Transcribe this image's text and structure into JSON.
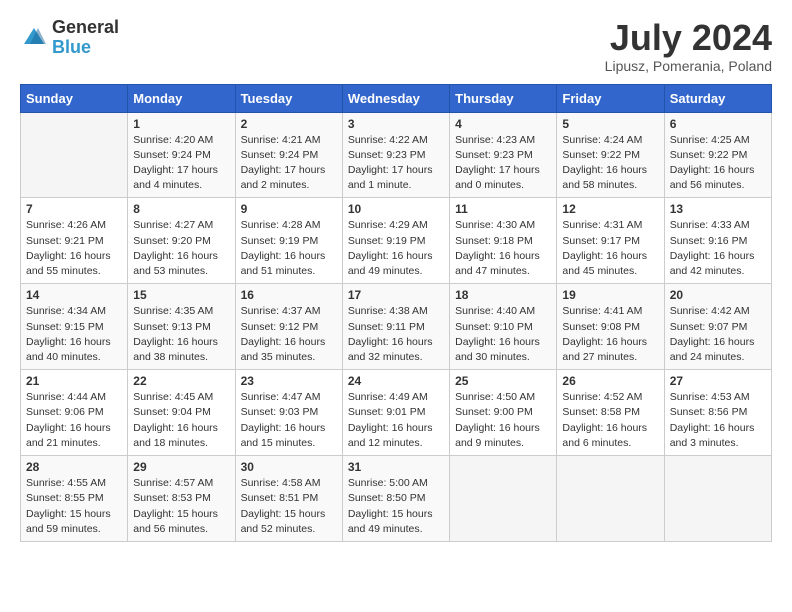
{
  "header": {
    "logo_general": "General",
    "logo_blue": "Blue",
    "title": "July 2024",
    "subtitle": "Lipusz, Pomerania, Poland"
  },
  "days_of_week": [
    "Sunday",
    "Monday",
    "Tuesday",
    "Wednesday",
    "Thursday",
    "Friday",
    "Saturday"
  ],
  "weeks": [
    [
      {
        "day": "",
        "info": ""
      },
      {
        "day": "1",
        "info": "Sunrise: 4:20 AM\nSunset: 9:24 PM\nDaylight: 17 hours\nand 4 minutes."
      },
      {
        "day": "2",
        "info": "Sunrise: 4:21 AM\nSunset: 9:24 PM\nDaylight: 17 hours\nand 2 minutes."
      },
      {
        "day": "3",
        "info": "Sunrise: 4:22 AM\nSunset: 9:23 PM\nDaylight: 17 hours\nand 1 minute."
      },
      {
        "day": "4",
        "info": "Sunrise: 4:23 AM\nSunset: 9:23 PM\nDaylight: 17 hours\nand 0 minutes."
      },
      {
        "day": "5",
        "info": "Sunrise: 4:24 AM\nSunset: 9:22 PM\nDaylight: 16 hours\nand 58 minutes."
      },
      {
        "day": "6",
        "info": "Sunrise: 4:25 AM\nSunset: 9:22 PM\nDaylight: 16 hours\nand 56 minutes."
      }
    ],
    [
      {
        "day": "7",
        "info": "Sunrise: 4:26 AM\nSunset: 9:21 PM\nDaylight: 16 hours\nand 55 minutes."
      },
      {
        "day": "8",
        "info": "Sunrise: 4:27 AM\nSunset: 9:20 PM\nDaylight: 16 hours\nand 53 minutes."
      },
      {
        "day": "9",
        "info": "Sunrise: 4:28 AM\nSunset: 9:19 PM\nDaylight: 16 hours\nand 51 minutes."
      },
      {
        "day": "10",
        "info": "Sunrise: 4:29 AM\nSunset: 9:19 PM\nDaylight: 16 hours\nand 49 minutes."
      },
      {
        "day": "11",
        "info": "Sunrise: 4:30 AM\nSunset: 9:18 PM\nDaylight: 16 hours\nand 47 minutes."
      },
      {
        "day": "12",
        "info": "Sunrise: 4:31 AM\nSunset: 9:17 PM\nDaylight: 16 hours\nand 45 minutes."
      },
      {
        "day": "13",
        "info": "Sunrise: 4:33 AM\nSunset: 9:16 PM\nDaylight: 16 hours\nand 42 minutes."
      }
    ],
    [
      {
        "day": "14",
        "info": "Sunrise: 4:34 AM\nSunset: 9:15 PM\nDaylight: 16 hours\nand 40 minutes."
      },
      {
        "day": "15",
        "info": "Sunrise: 4:35 AM\nSunset: 9:13 PM\nDaylight: 16 hours\nand 38 minutes."
      },
      {
        "day": "16",
        "info": "Sunrise: 4:37 AM\nSunset: 9:12 PM\nDaylight: 16 hours\nand 35 minutes."
      },
      {
        "day": "17",
        "info": "Sunrise: 4:38 AM\nSunset: 9:11 PM\nDaylight: 16 hours\nand 32 minutes."
      },
      {
        "day": "18",
        "info": "Sunrise: 4:40 AM\nSunset: 9:10 PM\nDaylight: 16 hours\nand 30 minutes."
      },
      {
        "day": "19",
        "info": "Sunrise: 4:41 AM\nSunset: 9:08 PM\nDaylight: 16 hours\nand 27 minutes."
      },
      {
        "day": "20",
        "info": "Sunrise: 4:42 AM\nSunset: 9:07 PM\nDaylight: 16 hours\nand 24 minutes."
      }
    ],
    [
      {
        "day": "21",
        "info": "Sunrise: 4:44 AM\nSunset: 9:06 PM\nDaylight: 16 hours\nand 21 minutes."
      },
      {
        "day": "22",
        "info": "Sunrise: 4:45 AM\nSunset: 9:04 PM\nDaylight: 16 hours\nand 18 minutes."
      },
      {
        "day": "23",
        "info": "Sunrise: 4:47 AM\nSunset: 9:03 PM\nDaylight: 16 hours\nand 15 minutes."
      },
      {
        "day": "24",
        "info": "Sunrise: 4:49 AM\nSunset: 9:01 PM\nDaylight: 16 hours\nand 12 minutes."
      },
      {
        "day": "25",
        "info": "Sunrise: 4:50 AM\nSunset: 9:00 PM\nDaylight: 16 hours\nand 9 minutes."
      },
      {
        "day": "26",
        "info": "Sunrise: 4:52 AM\nSunset: 8:58 PM\nDaylight: 16 hours\nand 6 minutes."
      },
      {
        "day": "27",
        "info": "Sunrise: 4:53 AM\nSunset: 8:56 PM\nDaylight: 16 hours\nand 3 minutes."
      }
    ],
    [
      {
        "day": "28",
        "info": "Sunrise: 4:55 AM\nSunset: 8:55 PM\nDaylight: 15 hours\nand 59 minutes."
      },
      {
        "day": "29",
        "info": "Sunrise: 4:57 AM\nSunset: 8:53 PM\nDaylight: 15 hours\nand 56 minutes."
      },
      {
        "day": "30",
        "info": "Sunrise: 4:58 AM\nSunset: 8:51 PM\nDaylight: 15 hours\nand 52 minutes."
      },
      {
        "day": "31",
        "info": "Sunrise: 5:00 AM\nSunset: 8:50 PM\nDaylight: 15 hours\nand 49 minutes."
      },
      {
        "day": "",
        "info": ""
      },
      {
        "day": "",
        "info": ""
      },
      {
        "day": "",
        "info": ""
      }
    ]
  ]
}
